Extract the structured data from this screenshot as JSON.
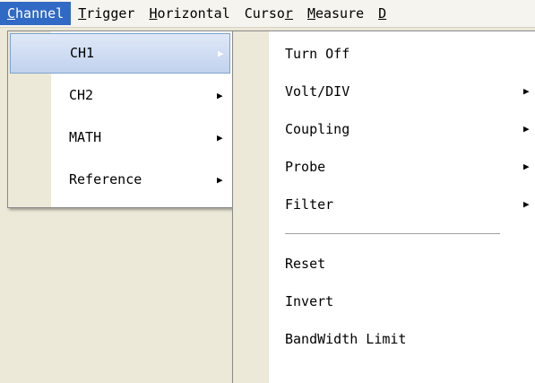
{
  "menubar": {
    "items": [
      {
        "label": "Channel",
        "mnemonic": "C",
        "rest": "hannel",
        "active": true
      },
      {
        "label": "Trigger",
        "mnemonic": "T",
        "rest": "rigger"
      },
      {
        "label": "Horizontal",
        "mnemonic": "H",
        "rest": "orizontal"
      },
      {
        "label": "Cursor",
        "pre": "Curso",
        "mnemonic": "r"
      },
      {
        "label": "Measure",
        "mnemonic": "M",
        "rest": "easure"
      },
      {
        "label": "D",
        "mnemonic": "D",
        "rest": ""
      }
    ]
  },
  "channel_menu": {
    "items": [
      {
        "label": "CH1",
        "has_submenu": true,
        "highlighted": true
      },
      {
        "label": "CH2",
        "has_submenu": true
      },
      {
        "label": "MATH",
        "has_submenu": true
      },
      {
        "label": "Reference",
        "has_submenu": true
      }
    ]
  },
  "ch1_submenu": {
    "items": [
      {
        "label": "Turn Off"
      },
      {
        "label": "Volt/DIV",
        "has_submenu": true
      },
      {
        "label": "Coupling",
        "has_submenu": true
      },
      {
        "label": "Probe",
        "has_submenu": true
      },
      {
        "label": "Filter",
        "has_submenu": true
      },
      {
        "separator": true
      },
      {
        "label": "Reset"
      },
      {
        "label": "Invert"
      },
      {
        "label": "BandWidth Limit"
      }
    ]
  },
  "icons": {
    "submenu_arrow": "▶"
  },
  "colors": {
    "menubar_active": "#316ac5",
    "highlight": "#c1d2ee",
    "gutter": "#ece9d8"
  }
}
